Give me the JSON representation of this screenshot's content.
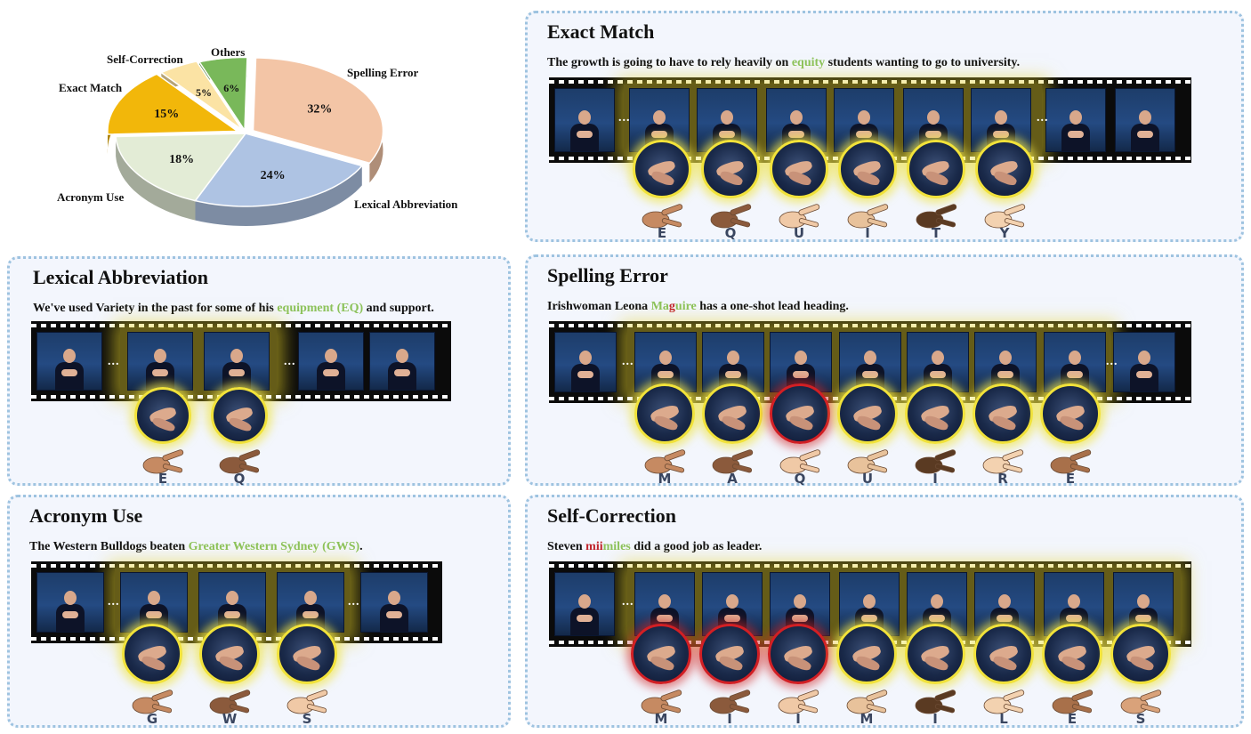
{
  "chart_data": {
    "type": "pie",
    "categories": [
      "Spelling Error",
      "Lexical Abbreviation",
      "Acronym Use",
      "Exact Match",
      "Self-Correction",
      "Others"
    ],
    "values": [
      32,
      24,
      18,
      15,
      5,
      6
    ],
    "value_labels": [
      "32%",
      "24%",
      "18%",
      "15%",
      "5%",
      "6%"
    ],
    "colors": [
      "#f3c5a6",
      "#aec3e3",
      "#e3ecd6",
      "#f2b70a",
      "#fbe3a4",
      "#79b85a"
    ]
  },
  "panels": {
    "exact_match": {
      "title": "Exact Match",
      "sentence_pre": "The growth is going to have to rely heavily on ",
      "sentence_hl": "equity",
      "sentence_post": " students wanting to go to university.",
      "letters": [
        "E",
        "Q",
        "U",
        "I",
        "T",
        "Y"
      ]
    },
    "lexical_abbreviation": {
      "title": "Lexical Abbreviation",
      "sentence_pre": "We've used Variety in the past for some of his ",
      "sentence_hl": "equipment (EQ)",
      "sentence_post": " and support.",
      "letters": [
        "E",
        "Q"
      ]
    },
    "spelling_error": {
      "title": "Spelling Error",
      "sentence_pre": "Irishwoman Leona ",
      "sentence_hl1": "Ma",
      "sentence_err": "g",
      "sentence_hl2": "uire",
      "sentence_post": " has a one-shot lead heading.",
      "letters": [
        "M",
        "A",
        "Q",
        "U",
        "I",
        "R",
        "E"
      ]
    },
    "acronym_use": {
      "title": "Acronym Use",
      "sentence_pre": "The Western Bulldogs beaten ",
      "sentence_hl": "Greater Western Sydney (GWS)",
      "sentence_post": ".",
      "letters": [
        "G",
        "W",
        "S"
      ]
    },
    "self_correction": {
      "title": "Self-Correction",
      "sentence_pre": "Steven ",
      "sentence_err": "mii",
      "sentence_hl": "miles",
      "sentence_post": " did a good job as leader.",
      "letters": [
        "M",
        "I",
        "I",
        "M",
        "I",
        "L",
        "E",
        "S"
      ]
    }
  },
  "ellipsis": "...",
  "colors": {
    "highlight_green": "#8cc25a",
    "error_red": "#c0232b",
    "panel_border": "#9ec3e0",
    "panel_bg": "#f3f6fd"
  }
}
